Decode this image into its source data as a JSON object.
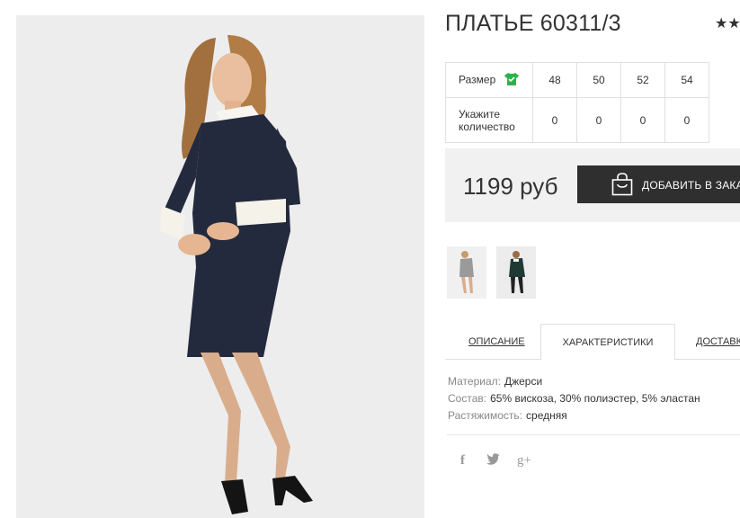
{
  "product": {
    "title": "ПЛАТЬЕ 60311/3",
    "rating_stars": "★★"
  },
  "sizes": {
    "size_label": "Размер",
    "qty_label": "Укажите количество",
    "values": [
      "48",
      "50",
      "52",
      "54"
    ],
    "quantities": [
      "0",
      "0",
      "0",
      "0"
    ]
  },
  "buy": {
    "price": "1199 руб",
    "add_label": "ДОБАВИТЬ В ЗАКАЗ"
  },
  "tabs": {
    "description": "ОПИСАНИЕ",
    "characteristics": "ХАРАКТЕРИСТИКИ",
    "delivery": "ДОСТАВКА"
  },
  "specs": [
    {
      "key": "Материал:",
      "value": "Джерси"
    },
    {
      "key": "Состав:",
      "value": "65% вискоза, 30% полиэстер, 5% эластан"
    },
    {
      "key": "Растяжимость:",
      "value": "средняя"
    }
  ],
  "social": {
    "facebook": "f",
    "twitter": "🐦",
    "gplus": "g+"
  },
  "colors": {
    "accent_green": "#2bb34a",
    "button_dark": "#2f2f2f",
    "dress_navy": "#232a3d"
  }
}
